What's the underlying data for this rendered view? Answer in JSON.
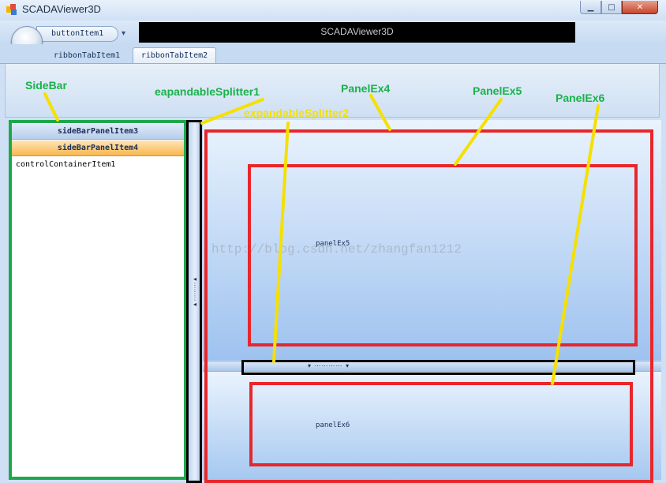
{
  "window": {
    "title": "SCADAViewer3D",
    "minimize_label": "▁",
    "maximize_label": "□",
    "close_label": "✕"
  },
  "ribbon": {
    "center_title": "SCADAViewer3D",
    "quick_access": {
      "button_label": "buttonItem1",
      "dropdown_label": "▾"
    },
    "tabs": [
      {
        "label": "ribbonTabItem1",
        "selected": false
      },
      {
        "label": "ribbonTabItem2",
        "selected": true
      }
    ]
  },
  "sidebar": {
    "panels": [
      {
        "label": "sideBarPanelItem3",
        "active": false
      },
      {
        "label": "sideBarPanelItem4",
        "active": true
      }
    ],
    "container_item": "controlContainerItem1"
  },
  "splitters": {
    "vertical_grip": "◂ ⋮ ◂",
    "horizontal_grip": "▾ ⋯⋯⋯⋯ ▾"
  },
  "panels": {
    "panel5_text": "panelEx5",
    "panel6_text": "panelEx6"
  },
  "watermark": "http://blog.csdn.net/zhangfan1212",
  "annotations": {
    "sidebar": "SideBar",
    "splitter1": "eapandableSplitter1",
    "splitter2": "expandableSplitter2",
    "panel4": "PanelEx4",
    "panel5": "PanelEx5",
    "panel6": "PanelEx6"
  },
  "colors": {
    "annotation_green": "#1ea84a",
    "annotation_red": "#e8262b",
    "annotation_yellow": "#f5e000",
    "active_panel_orange": "#f9b74d"
  },
  "icons": {
    "app": "app-icon",
    "orb": "application-orb"
  }
}
